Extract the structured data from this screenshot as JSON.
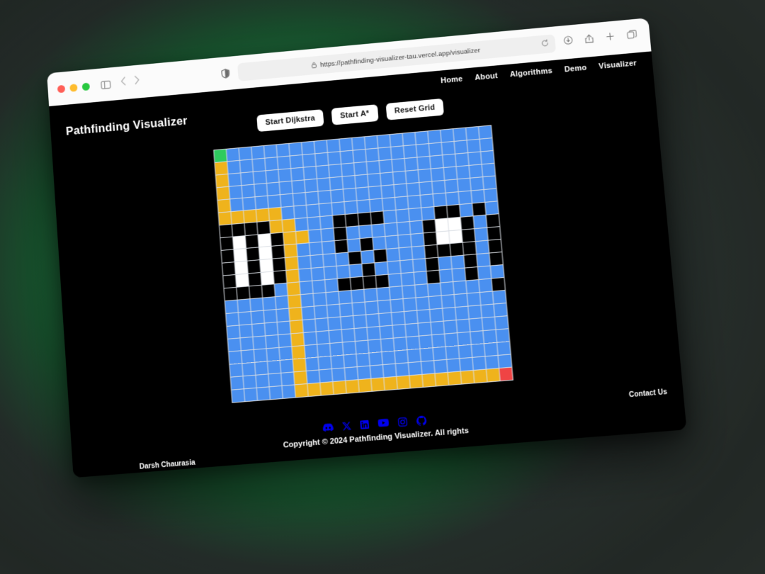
{
  "browser": {
    "url": "https://pathfinding-visualizer-tau.vercel.app/visualizer",
    "lock_icon": "lock-icon",
    "reload_icon": "reload-icon",
    "sidebar_icon": "sidebar-toggle-icon",
    "back_icon": "back-arrow-icon",
    "forward_icon": "forward-arrow-icon",
    "shield_icon": "shield-privacy-icon",
    "right_icons": [
      "downloads-icon",
      "share-icon",
      "new-tab-icon",
      "tab-overview-icon"
    ],
    "traffic_lights": [
      "close-red",
      "minimize-yellow",
      "zoom-green"
    ]
  },
  "nav": {
    "items": [
      {
        "label": "Home"
      },
      {
        "label": "About"
      },
      {
        "label": "Algorithms"
      },
      {
        "label": "Demo"
      },
      {
        "label": "Visualizer"
      }
    ]
  },
  "header": {
    "brand": "Pathfinding Visualizer"
  },
  "toolbar": {
    "buttons": [
      {
        "label": "Start Dijkstra",
        "name": "start-dijkstra-button"
      },
      {
        "label": "Start A*",
        "name": "start-astar-button"
      },
      {
        "label": "Reset Grid",
        "name": "reset-grid-button"
      }
    ]
  },
  "grid": {
    "cols": 22,
    "rows": 20,
    "colors": {
      "visited": "#4a90f0",
      "wall": "#000000",
      "letter_fill": "#ffffff",
      "path": "#efb31c",
      "start": "#2ecc5f",
      "end": "#ef4444",
      "gridline": "#d9dde3"
    },
    "legend": {
      "start": "Start node (green, top-left)",
      "end": "End node (red, bottom-right)",
      "path": "Shortest path (yellow)",
      "visited": "Visited node (blue)",
      "wall": "Wall (black) — spells DSA!"
    },
    "cells": [
      "SBBBBBBBBBBBBBBBBBBBBB",
      "PBBBBBBBBBBBBBBBBBBBBB",
      "PBBBBBBBBBBBBBBBBBBBBB",
      "PBBBBBBBBBBBBBBBBBBBBB",
      "PBBBBBBBBBBBBBBBBBBBBB",
      "PPPPPBBBBBBBBBBBBBBBBB",
      "WWWWPPBBBWWWWBBBBWWBWB",
      "WFWFWPPBBWBBBBBBWFFWBW",
      "WFWFWPBBBWBWBBBBWFFWBW",
      "WFWFWPBBBBWBWBBBWWWWBW",
      "WFWFWPBBBBBWBBBBWBBWBW",
      "WWWWBPBBBWWWWBBBWBBWBB",
      "BBBBBPBBBBBBBBBBBBBBBW",
      "BBBBBPBBBBBBBBBBBBBBBB",
      "BBBBBPBBBBBBBBBBBBBBBB",
      "BBBBBPBBBBBBBBBBBBBBBB",
      "BBBBBPBBBBBBBBBBBBBBBB",
      "BBBBBPBBBBBBBBBBBBBBBB",
      "BBBBBPBBBBBBBBBBBBBBBB",
      "BBBBBPPPPPPPPPPPPPPPPE"
    ]
  },
  "footer": {
    "socials": [
      {
        "name": "discord-icon"
      },
      {
        "name": "x-twitter-icon"
      },
      {
        "name": "linkedin-icon"
      },
      {
        "name": "youtube-icon"
      },
      {
        "name": "instagram-icon"
      },
      {
        "name": "github-icon"
      }
    ],
    "copyright": "Copyright © 2024 Pathfinding Visualizer. All rights",
    "contact": "Contact Us",
    "author": "Darsh Chaurasia"
  }
}
